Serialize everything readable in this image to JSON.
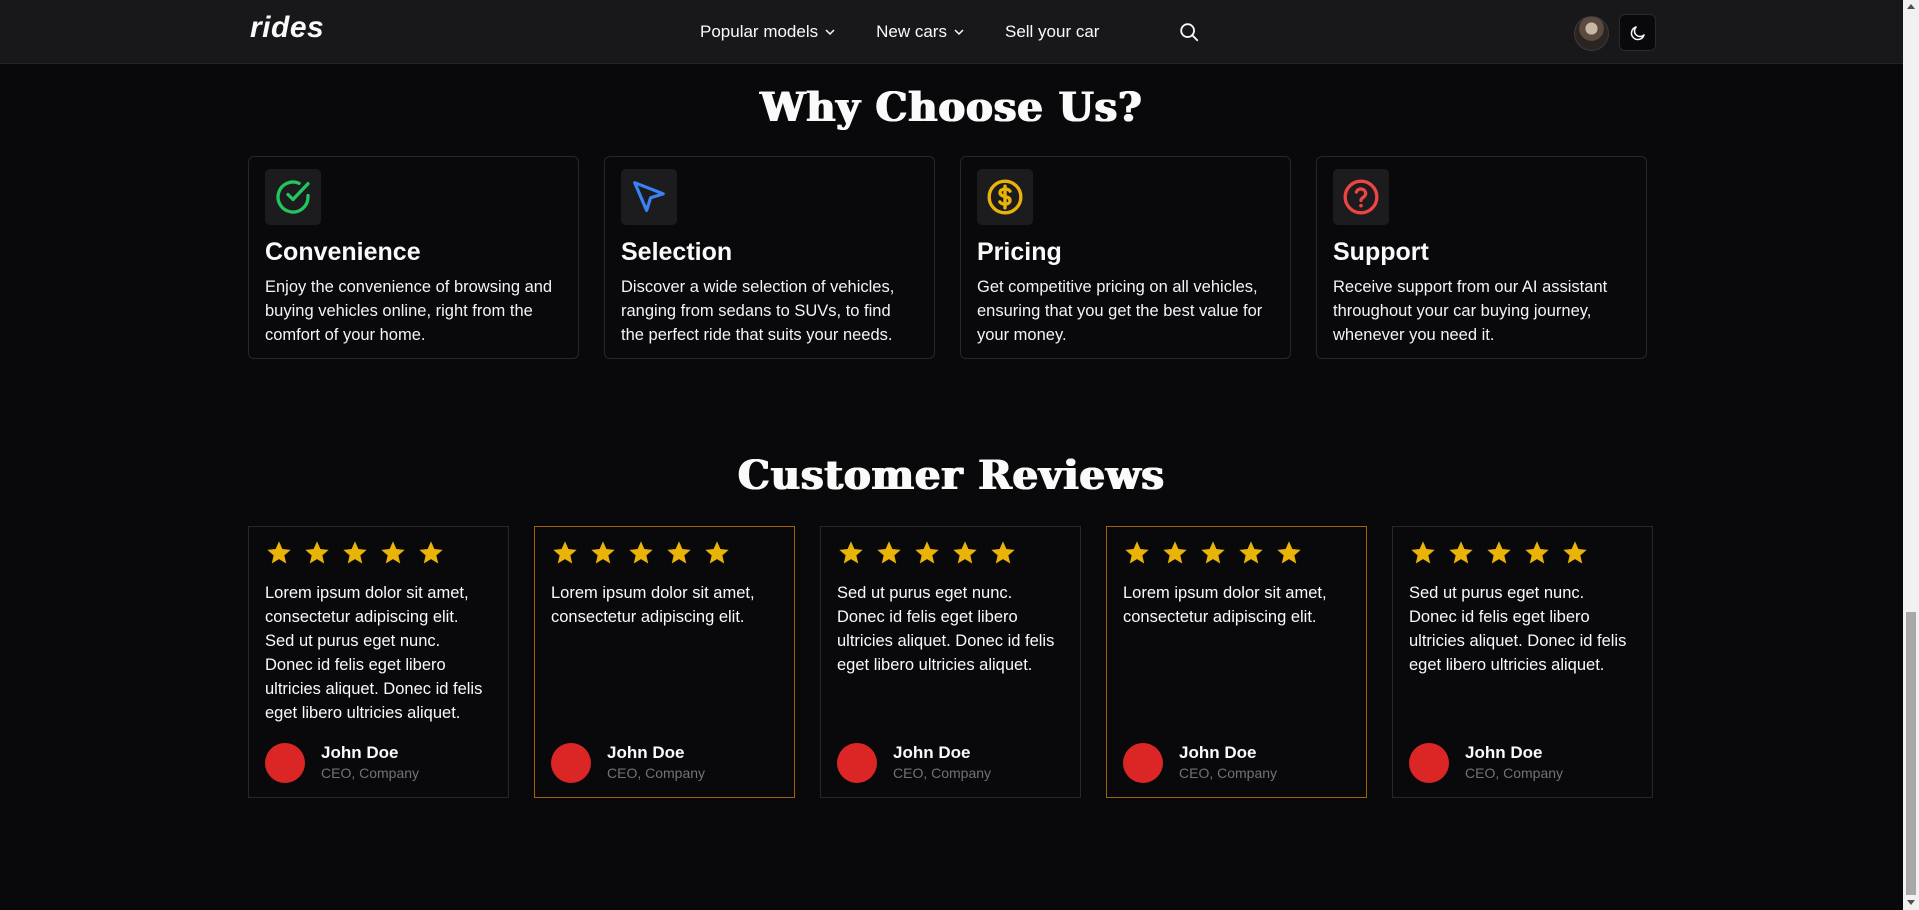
{
  "nav": {
    "logo": "rides",
    "links": [
      {
        "label": "Popular models",
        "has_dropdown": true
      },
      {
        "label": "New cars",
        "has_dropdown": true
      },
      {
        "label": "Sell your car",
        "has_dropdown": false
      }
    ],
    "search_icon": "search-icon",
    "theme_icon": "moon-icon"
  },
  "why": {
    "title": "Why Choose Us?",
    "features": [
      {
        "icon": "check-circle-icon",
        "color": "#22c55e",
        "title": "Convenience",
        "text": "Enjoy the convenience of browsing and buying vehicles online, right from the comfort of your home."
      },
      {
        "icon": "cursor-arrow-icon",
        "color": "#3b82f6",
        "title": "Selection",
        "text": "Discover a wide selection of vehicles, ranging from sedans to SUVs, to find the perfect ride that suits your needs."
      },
      {
        "icon": "dollar-circle-icon",
        "color": "#eab308",
        "title": "Pricing",
        "text": "Get competitive pricing on all vehicles, ensuring that you get the best value for your money."
      },
      {
        "icon": "question-circle-icon",
        "color": "#ef4444",
        "title": "Support",
        "text": "Receive support from our AI assistant throughout your car buying journey, whenever you need it."
      }
    ]
  },
  "reviews": {
    "title": "Customer Reviews",
    "star_color": "#eab308",
    "items": [
      {
        "rating": 5,
        "highlight": false,
        "text": "Lorem ipsum dolor sit amet, consectetur adipiscing elit. Sed ut purus eget nunc. Donec id felis eget libero ultricies aliquet. Donec id felis eget libero ultricies aliquet.",
        "name": "John Doe",
        "role": "CEO, Company"
      },
      {
        "rating": 5,
        "highlight": true,
        "text": "Lorem ipsum dolor sit amet, consectetur adipiscing elit.",
        "name": "John Doe",
        "role": "CEO, Company"
      },
      {
        "rating": 5,
        "highlight": false,
        "text": "Sed ut purus eget nunc. Donec id felis eget libero ultricies aliquet. Donec id felis eget libero ultricies aliquet.",
        "name": "John Doe",
        "role": "CEO, Company"
      },
      {
        "rating": 5,
        "highlight": true,
        "text": "Lorem ipsum dolor sit amet, consectetur adipiscing elit.",
        "name": "John Doe",
        "role": "CEO, Company"
      },
      {
        "rating": 5,
        "highlight": false,
        "text": "Sed ut purus eget nunc. Donec id felis eget libero ultricies aliquet. Donec id felis eget libero ultricies aliquet.",
        "name": "John Doe",
        "role": "CEO, Company"
      }
    ],
    "avatar_color": "#dc2626"
  }
}
